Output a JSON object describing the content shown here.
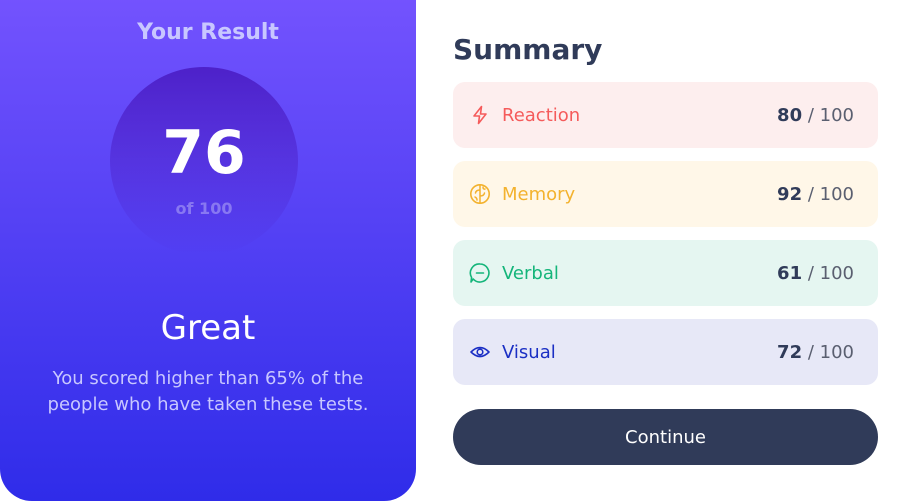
{
  "result": {
    "heading": "Your Result",
    "score": "76",
    "of_label": "of 100",
    "rating": "Great",
    "description": "You scored higher than 65% of the people who have taken these tests."
  },
  "summary": {
    "title": "Summary",
    "items": [
      {
        "label": "Reaction",
        "value": "80",
        "max": "/ 100",
        "icon": "lightning-icon",
        "color": "#f55b5b",
        "bg": "#fdeeee"
      },
      {
        "label": "Memory",
        "value": "92",
        "max": "/ 100",
        "icon": "brain-icon",
        "color": "#f3b22e",
        "bg": "#fff7e8"
      },
      {
        "label": "Verbal",
        "value": "61",
        "max": "/ 100",
        "icon": "chat-icon",
        "color": "#14b57a",
        "bg": "#e5f6f1"
      },
      {
        "label": "Visual",
        "value": "72",
        "max": "/ 100",
        "icon": "eye-icon",
        "color": "#1b2fc4",
        "bg": "#e7e8f7"
      }
    ]
  },
  "continue_label": "Continue",
  "colors": {
    "gradient_top": "#7755ff",
    "gradient_bottom": "#2f2ce9",
    "dark": "#303b59"
  }
}
